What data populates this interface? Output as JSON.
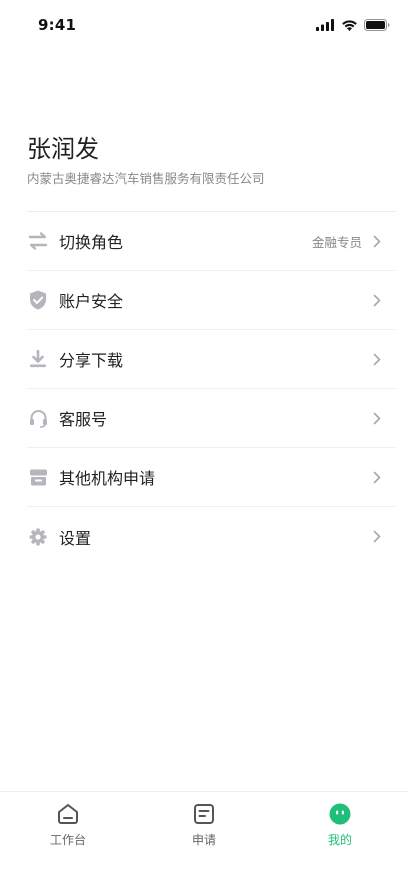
{
  "status_bar": {
    "time": "9:41"
  },
  "profile": {
    "name": "张润发",
    "company": "内蒙古奥捷睿达汽车销售服务有限责任公司"
  },
  "menu": {
    "items": [
      {
        "label": "切换角色",
        "value": "金融专员",
        "icon": "switch-arrows-icon"
      },
      {
        "label": "账户安全",
        "value": "",
        "icon": "shield-check-icon"
      },
      {
        "label": "分享下载",
        "value": "",
        "icon": "download-icon"
      },
      {
        "label": "客服号",
        "value": "",
        "icon": "headset-icon"
      },
      {
        "label": "其他机构申请",
        "value": "",
        "icon": "store-icon"
      },
      {
        "label": "设置",
        "value": "",
        "icon": "gear-icon"
      }
    ]
  },
  "tabs": [
    {
      "label": "工作台",
      "icon": "home-icon",
      "active": false
    },
    {
      "label": "申请",
      "icon": "document-icon",
      "active": false
    },
    {
      "label": "我的",
      "icon": "profile-face-icon",
      "active": true
    }
  ],
  "colors": {
    "accent": "#1fbf79",
    "icon_gray": "#b5b5bd",
    "text": "#222222",
    "muted": "#888888"
  }
}
